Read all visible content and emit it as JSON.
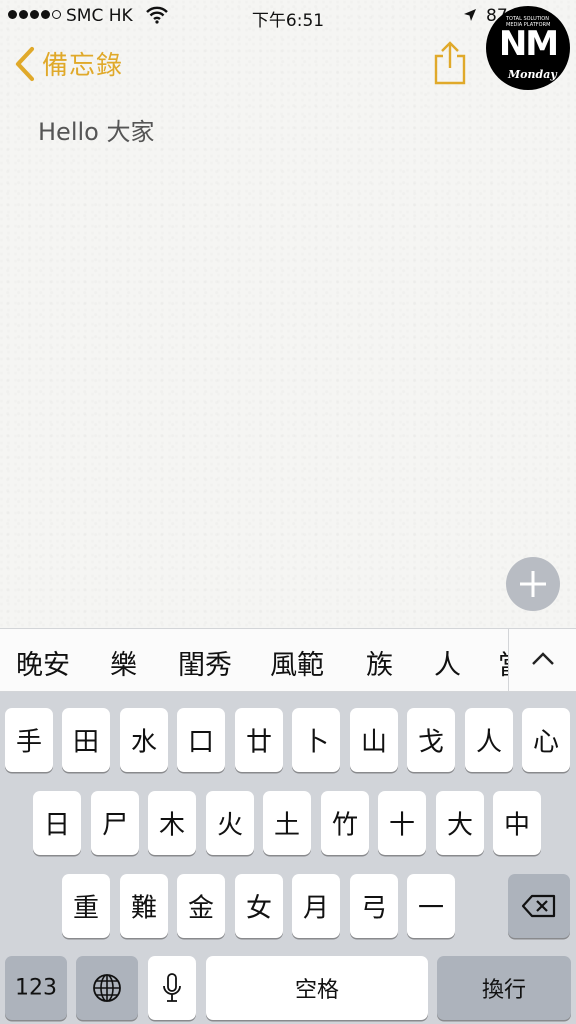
{
  "status_bar": {
    "carrier": "SMC HK",
    "time": "下午6:51",
    "battery_text": "87"
  },
  "nav": {
    "back_label": "備忘錄"
  },
  "watermark": {
    "mark": "NM",
    "line1": "TOTAL SOLUTION",
    "line2": "MEDIA PLATFORM",
    "brand": "Monday"
  },
  "note": {
    "text": "Hello 大家"
  },
  "candidates": [
    "晚安",
    "樂",
    "閨秀",
    "風範",
    "族",
    "人",
    "當"
  ],
  "keyboard": {
    "row1": [
      "手",
      "田",
      "水",
      "口",
      "廿",
      "卜",
      "山",
      "戈",
      "人",
      "心"
    ],
    "row2": [
      "日",
      "尸",
      "木",
      "火",
      "土",
      "竹",
      "十",
      "大",
      "中"
    ],
    "row3": [
      "重",
      "難",
      "金",
      "女",
      "月",
      "弓",
      "一"
    ],
    "numbers_label": "123",
    "space_label": "空格",
    "return_label": "換行"
  },
  "colors": {
    "accent": "#e0a92a",
    "keyboard_bg": "#d1d4d9",
    "dark_key": "#adb3bc"
  }
}
